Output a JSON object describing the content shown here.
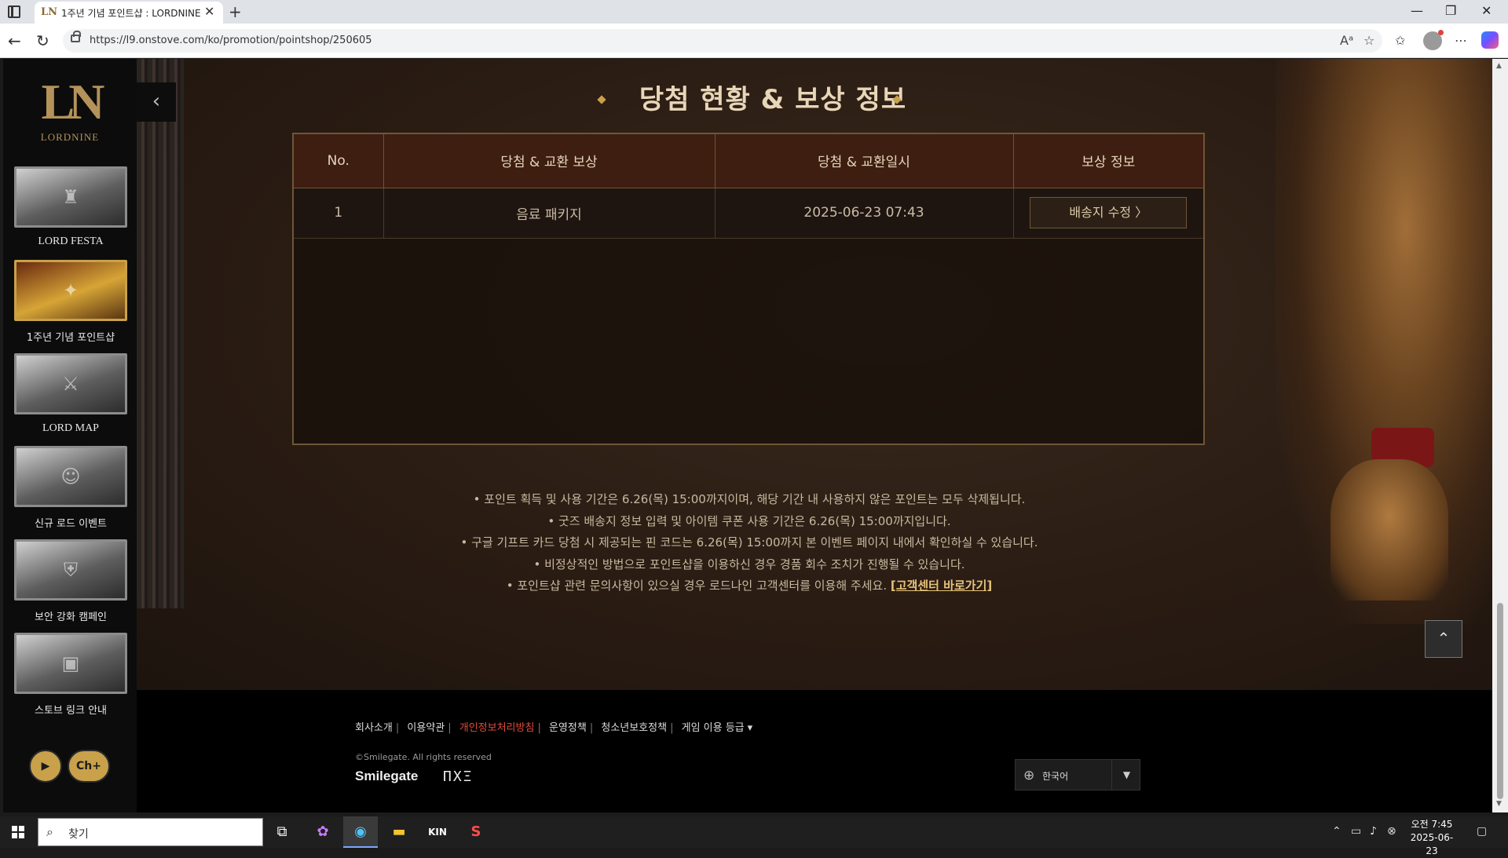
{
  "browser": {
    "tab_title": "1주년 기념 포인트샵 : LORDNINE",
    "url": "https://l9.onstove.com/ko/promotion/pointshop/250605"
  },
  "sidebar": {
    "logo_mark": "LN",
    "logo_text": "LORDNINE",
    "items": [
      {
        "label": "LORD FESTA",
        "active": false
      },
      {
        "label": "1주년 기념 포인트샵",
        "active": true
      },
      {
        "label": "LORD MAP",
        "active": false
      },
      {
        "label": "신규 로드 이벤트",
        "active": false
      },
      {
        "label": "보안 강화 캠페인",
        "active": false
      },
      {
        "label": "스토브 링크 안내",
        "active": false
      }
    ],
    "social": [
      "youtube-icon",
      "channel-plus-icon"
    ]
  },
  "main": {
    "title": "당첨 현황 & 보상 정보",
    "table": {
      "headers": [
        "No.",
        "당첨 & 교환 보상",
        "당첨 & 교환일시",
        "보상 정보"
      ],
      "rows": [
        {
          "no": "1",
          "reward": "음료 패키지",
          "datetime": "2025-06-23 07:43",
          "action": "배송지 수정 〉"
        }
      ]
    },
    "notices": [
      "• 포인트 획득 및 사용 기간은 6.26(목) 15:00까지이며, 해당 기간 내 사용하지 않은 포인트는 모두 삭제됩니다.",
      "• 굿즈 배송지 정보 입력 및 아이템 쿠폰 사용 기간은 6.26(목) 15:00까지입니다.",
      "• 구글 기프트 카드 당첨 시 제공되는 핀 코드는 6.26(목) 15:00까지 본 이벤트 페이지 내에서 확인하실 수 있습니다.",
      "• 비정상적인 방법으로 포인트샵을 이용하신 경우 경품 회수 조치가 진행될 수 있습니다."
    ],
    "last_notice": "•  포인트샵 관련 문의사항이 있으실 경우 로드나인 고객센터를 이용해 주세요.",
    "support_link": "[고객센터 바로가기]"
  },
  "footer": {
    "links": [
      "회사소개",
      "이용약관",
      "개인정보처리방침",
      "운영정책",
      "청소년보호정책",
      "게임 이용 등급"
    ],
    "copyright": "©Smilegate. All rights reserved",
    "brand1": "Smilegate",
    "brand2": "ΠXΞ",
    "language": "한국어"
  },
  "taskbar": {
    "search_placeholder": "찾기",
    "clock_time": "오전 7:45",
    "clock_date": "2025-06-23"
  },
  "colors": {
    "accent_gold": "#c9a14a",
    "table_header": "#3e1e10",
    "highlight_red": "#e24a3b"
  }
}
